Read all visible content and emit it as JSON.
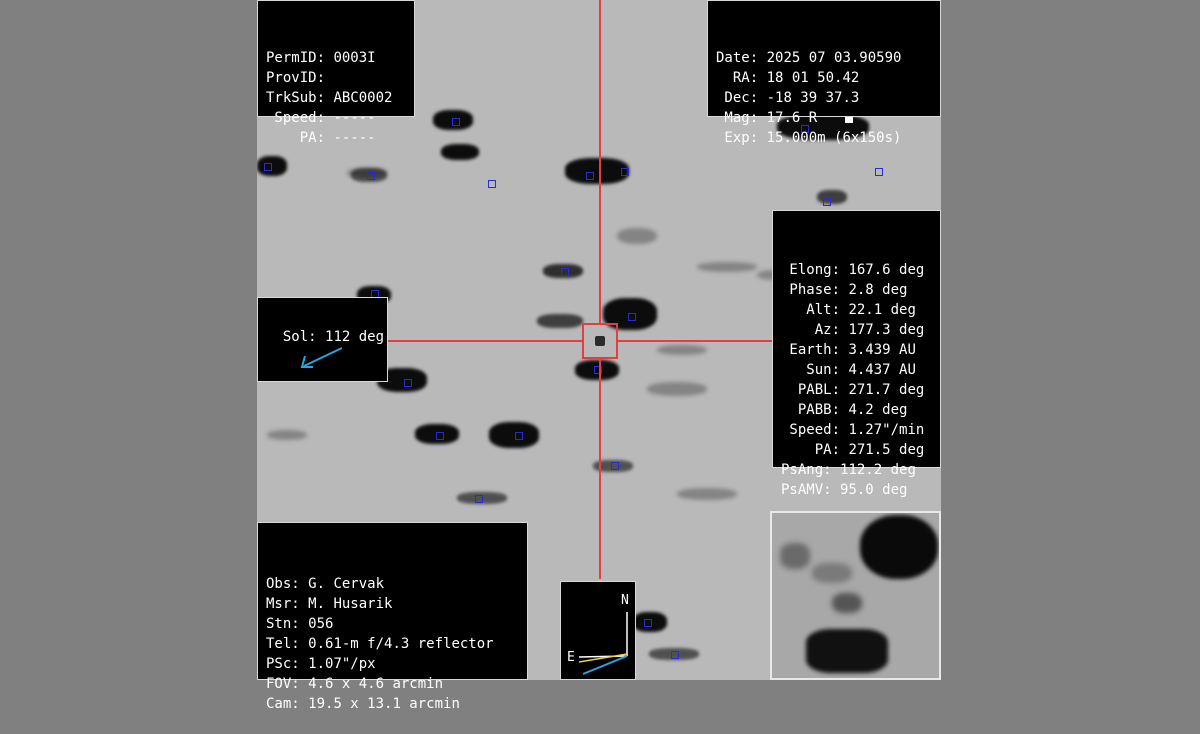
{
  "header": {
    "lines": [
      {
        "key": "PermID:",
        "value": "0003I"
      },
      {
        "key": "ProvID:",
        "value": ""
      },
      {
        "key": "TrkSub:",
        "value": "ABC0002"
      },
      {
        "key": " Speed:",
        "value": "-----"
      },
      {
        "key": "    PA:",
        "value": "-----"
      }
    ]
  },
  "observation": {
    "lines": [
      {
        "key": "Date:",
        "value": "2025 07 03.90590"
      },
      {
        "key": "  RA:",
        "value": "18 01 50.42"
      },
      {
        "key": " Dec:",
        "value": "-18 39 37.3"
      },
      {
        "key": " Mag:",
        "value": "17.6 R"
      },
      {
        "key": " Exp:",
        "value": "15.000m (6x150s)"
      }
    ]
  },
  "geometry": {
    "lines": [
      {
        "key": " Elong:",
        "value": "167.6 deg"
      },
      {
        "key": " Phase:",
        "value": "2.8 deg"
      },
      {
        "key": "   Alt:",
        "value": "22.1 deg"
      },
      {
        "key": "    Az:",
        "value": "177.3 deg"
      },
      {
        "key": " Earth:",
        "value": "3.439 AU"
      },
      {
        "key": "   Sun:",
        "value": "4.437 AU"
      },
      {
        "key": "  PABL:",
        "value": "271.7 deg"
      },
      {
        "key": "  PABB:",
        "value": "4.2 deg"
      },
      {
        "key": " Speed:",
        "value": "1.27\"/min"
      },
      {
        "key": "    PA:",
        "value": "271.5 deg"
      },
      {
        "key": "PsAng:",
        "value": "112.2 deg"
      },
      {
        "key": "PsAMV:",
        "value": "95.0 deg"
      }
    ]
  },
  "sol": {
    "key": "Sol:",
    "value": "112 deg",
    "arrow_color": "#2fa0e0"
  },
  "observer": {
    "lines": [
      {
        "key": "Obs:",
        "value": "G. Cervak"
      },
      {
        "key": "Msr:",
        "value": "M. Husarik"
      },
      {
        "key": "Stn:",
        "value": "056"
      },
      {
        "key": "Tel:",
        "value": "0.61-m f/4.3 reflector"
      },
      {
        "key": "PSc:",
        "value": "1.07\"/px"
      },
      {
        "key": "FOV:",
        "value": "4.6 x 4.6 arcmin"
      },
      {
        "key": "Cam:",
        "value": "19.5 x 13.1 arcmin"
      }
    ]
  },
  "compass": {
    "north_label": "N",
    "east_label": "E"
  },
  "colors": {
    "crosshair": "#e24040",
    "marker": "#2b2bd6",
    "background": "#808080",
    "panel": "#000000"
  }
}
